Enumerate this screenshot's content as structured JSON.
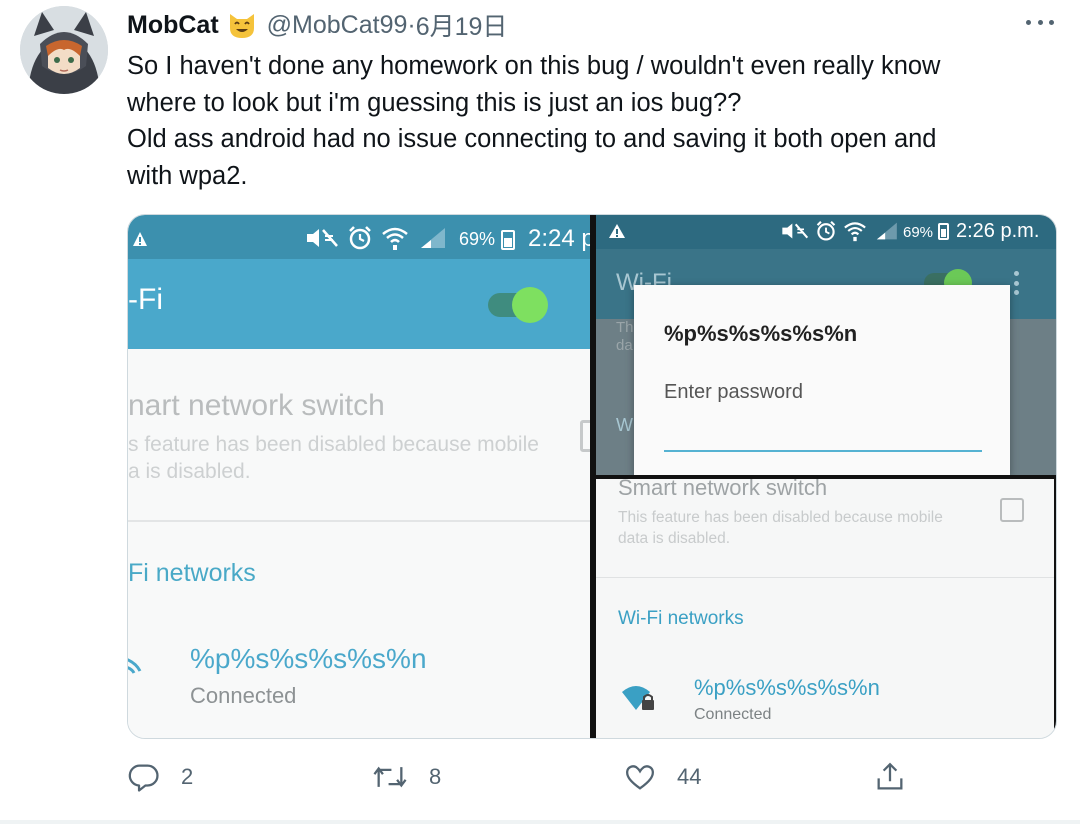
{
  "tweet": {
    "display_name": "MobCat",
    "handle": "@MobCat99",
    "separator": " · ",
    "date": "6月19日",
    "text_lines": [
      "So I haven't done any homework on this bug / wouldn't even really know",
      "where to look but i'm guessing this is just an ios bug??",
      "Old ass android had no issue connecting to and saving it both open and",
      "with wpa2."
    ]
  },
  "left_screenshot": {
    "battery_pct": "69%",
    "time": "2:24 p",
    "appbar_title": "-Fi",
    "toggle_on": true,
    "smart_title": "nart network switch",
    "smart_desc_1": "s feature has been disabled because mobile",
    "smart_desc_2": "a is disabled.",
    "section": "Fi networks",
    "network_name": "%p%s%s%s%s%n",
    "network_status": "Connected"
  },
  "right_screenshot": {
    "battery_pct": "69%",
    "time": "2:26 p.m.",
    "appbar_title": "Wi-Fi",
    "dim_text_1": "Th",
    "dim_text_2": "da",
    "dim_text_3": "W",
    "dialog_ssid": "%p%s%s%s%s%n",
    "dialog_hint": "Enter password",
    "smart_title": "Smart network switch",
    "smart_desc_1": "This feature has been disabled because mobile",
    "smart_desc_2": "data is disabled.",
    "section": "Wi-Fi networks",
    "network_name": "%p%s%s%s%s%n",
    "network_status": "Connected"
  },
  "actions": {
    "reply_count": "2",
    "retweet_count": "8",
    "like_count": "44"
  },
  "colors": {
    "accent": "#1d9bf0",
    "android_teal": "#4aa8cb",
    "muted": "#536471"
  },
  "icons": [
    "avatar",
    "cat-emoji-icon",
    "more-icon",
    "warning-icon",
    "mute-icon",
    "alarm-icon",
    "wifi-icon",
    "signal-icon",
    "battery-icon",
    "reply-icon",
    "retweet-icon",
    "like-icon",
    "share-icon"
  ]
}
